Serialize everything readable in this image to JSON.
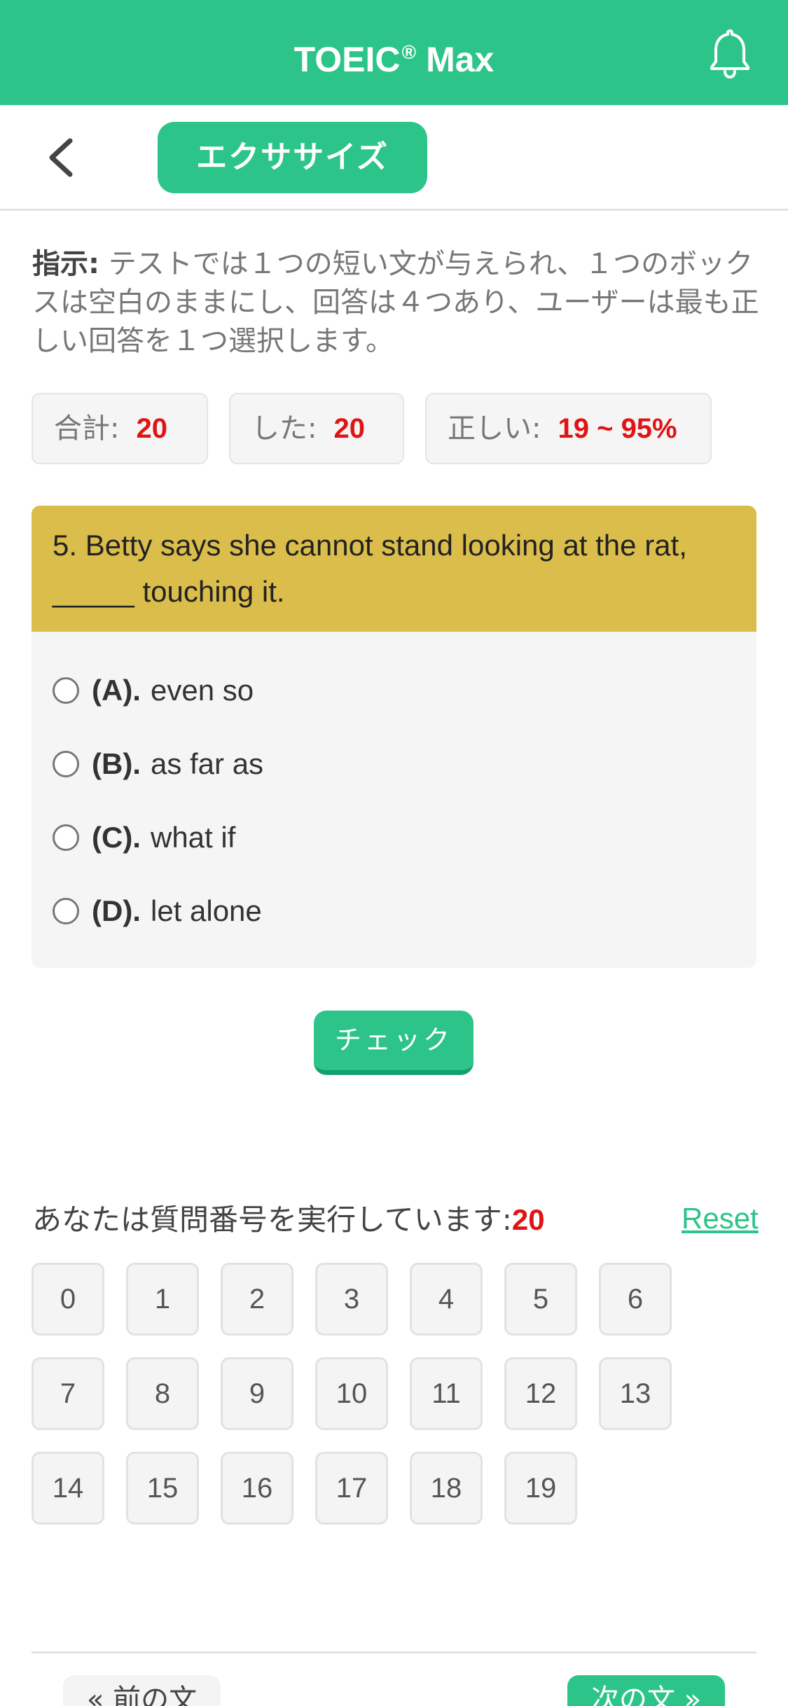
{
  "app": {
    "title": "TOEIC",
    "title_mark": "®",
    "title_suffix": " Max"
  },
  "icons": {
    "notification": "bell-icon",
    "back": "chevron-left-icon"
  },
  "subbar": {
    "tab_label": "エクササイズ"
  },
  "instructions": {
    "label": "指示:",
    "text": " テストでは１つの短い文が与えられ、１つのボックスは空白のままにし、回答は４つあり、ユーザーは最も正しい回答を１つ選択します。"
  },
  "stats": {
    "total_label": "合計:",
    "total_value": "20",
    "done_label": "した:",
    "done_value": "20",
    "correct_label": "正しい:",
    "correct_value": "19 ~ 95%"
  },
  "question": {
    "text": "5. Betty says she cannot stand looking at the rat, _____ touching it.",
    "options": [
      {
        "label": "(A).",
        "text": "even so"
      },
      {
        "label": "(B).",
        "text": "as far as"
      },
      {
        "label": "(C).",
        "text": "what if"
      },
      {
        "label": "(D).",
        "text": "let alone"
      }
    ]
  },
  "check_button": "チェック",
  "progress": {
    "label": "あなたは質問番号を実行しています:",
    "current": "20",
    "reset": "Reset"
  },
  "question_numbers": [
    "0",
    "1",
    "2",
    "3",
    "4",
    "5",
    "6",
    "7",
    "8",
    "9",
    "10",
    "11",
    "12",
    "13",
    "14",
    "15",
    "16",
    "17",
    "18",
    "19"
  ],
  "nav": {
    "prev": "« 前の文",
    "next": "次の文 »"
  },
  "colors": {
    "brand": "#2dc48a",
    "question_bg": "#dbbd4b",
    "accent_red": "#e01414"
  }
}
